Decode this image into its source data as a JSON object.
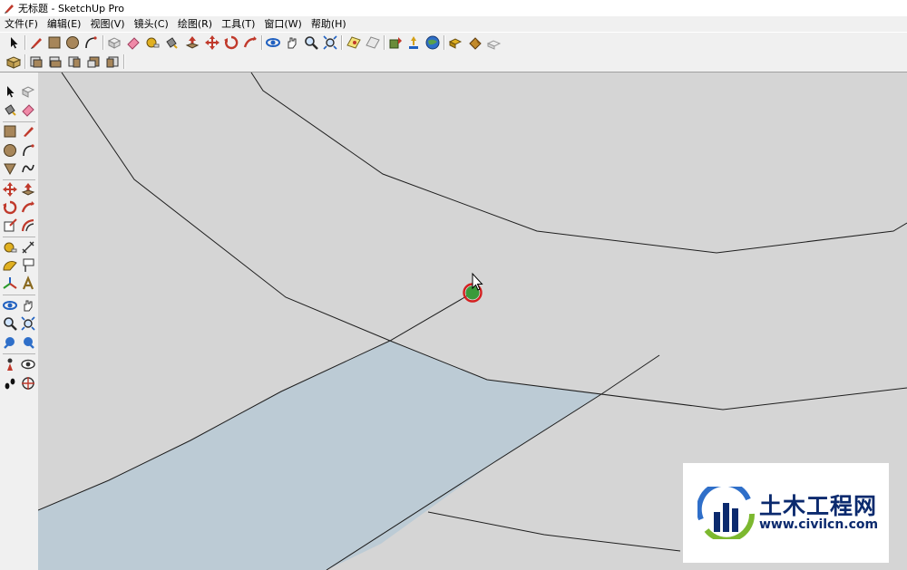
{
  "window": {
    "title": "无标题 - SketchUp Pro"
  },
  "menu": [
    "文件(F)",
    "编辑(E)",
    "视图(V)",
    "镜头(C)",
    "绘图(R)",
    "工具(T)",
    "窗口(W)",
    "帮助(H)"
  ],
  "watermark": {
    "chinese": "土木工程网",
    "url": "www.civilcn.com"
  },
  "colors": {
    "viewport": "#d5d5d5",
    "face": "#bccbd5",
    "edge": "#1e1e1e",
    "inference_point": "#3a9a3a",
    "inference_ring": "#d42020",
    "watermark_blue": "#0b2a6e"
  },
  "icons": {
    "main_toolbar": [
      "select-icon",
      "pencil-icon",
      "rectangle-icon",
      "circle-icon",
      "arc-icon",
      "make-component-icon",
      "eraser-icon",
      "tape-measure-icon",
      "paint-bucket-icon",
      "push-pull-icon",
      "move-icon",
      "rotate-icon",
      "follow-me-icon",
      "orbit-icon",
      "pan-icon",
      "zoom-icon",
      "zoom-extents-icon",
      "add-location-icon",
      "toggle-terrain-icon",
      "get-models-icon",
      "share-model-icon",
      "google-earth-icon",
      "components-icon",
      "styles-icon",
      "materials-icon"
    ],
    "views_toolbar": [
      "iso-view-icon",
      "top-view-icon",
      "front-view-icon",
      "right-view-icon",
      "back-view-icon",
      "left-view-icon"
    ]
  }
}
